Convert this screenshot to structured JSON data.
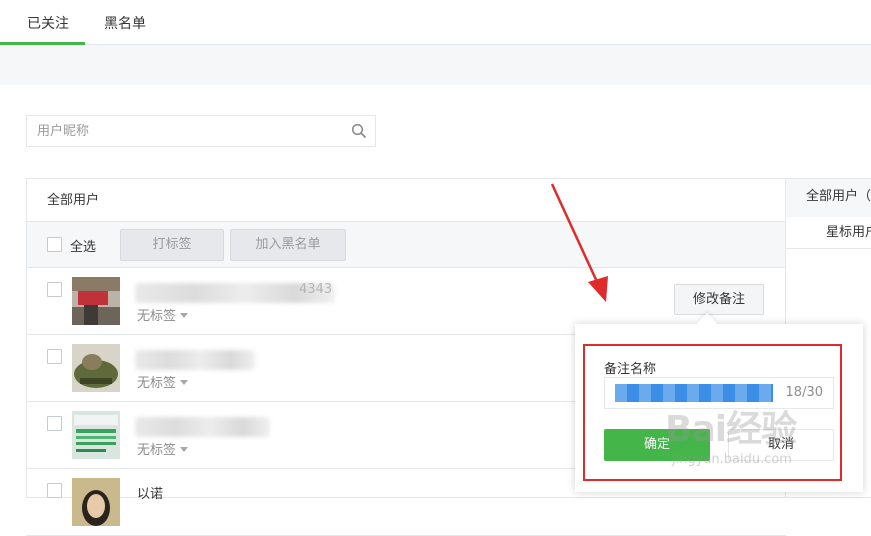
{
  "tabs": [
    {
      "label": "已关注",
      "active": true
    },
    {
      "label": "黑名单",
      "active": false
    }
  ],
  "search": {
    "placeholder": "用户昵称",
    "icon": "search-icon"
  },
  "list": {
    "header": "全部用户",
    "select_all": "全选",
    "tag_button": "打标签",
    "blacklist_button": "加入黑名单",
    "rows": [
      {
        "name": "4343",
        "tag": "无标签"
      },
      {
        "name": "",
        "tag": "无标签"
      },
      {
        "name": "",
        "tag": "无标签"
      },
      {
        "name": "以诺",
        "tag": ""
      }
    ]
  },
  "remark_button": "修改备注",
  "side": {
    "item1": "全部用户（",
    "item2": "星标用户"
  },
  "popup": {
    "label": "备注名称",
    "counter": "18/30",
    "confirm": "确定",
    "cancel": "取消"
  },
  "watermark": {
    "text": "Bai经验",
    "sub": "jingyan.baidu.com"
  },
  "colors": {
    "accent": "#44b549",
    "annotation": "#e02b2b",
    "selection": "#3a8ee6"
  }
}
